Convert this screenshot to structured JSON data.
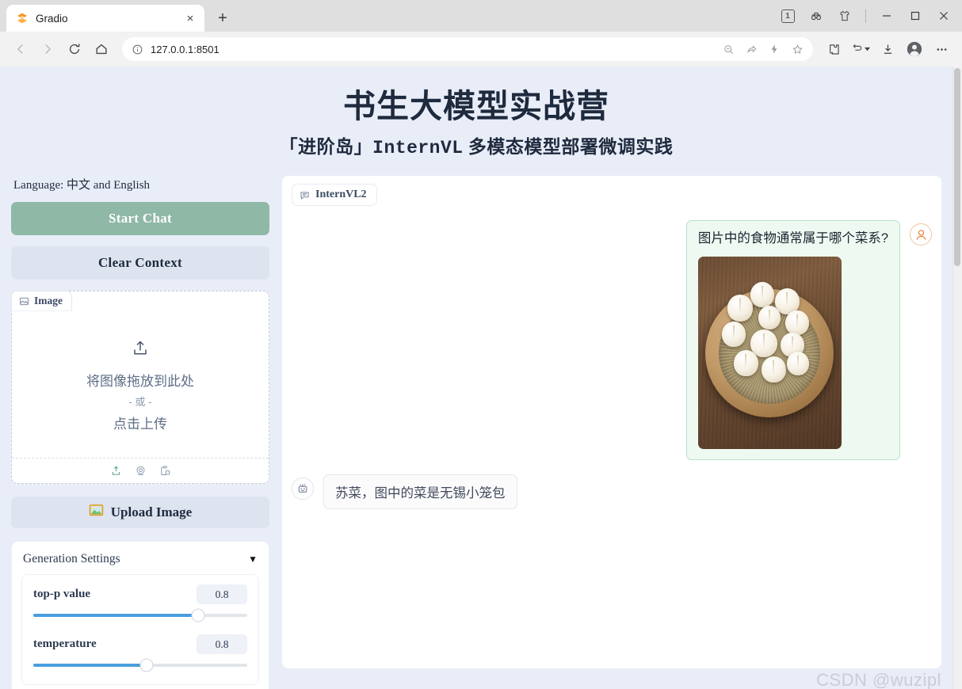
{
  "browser": {
    "tab": {
      "title": "Gradio",
      "favicon": "gradio-logo-icon",
      "close": "×"
    },
    "new_tab": "+",
    "nav": {
      "back": "back-icon",
      "forward": "forward-icon",
      "reload": "reload-icon",
      "home": "home-icon"
    },
    "omnibox": {
      "url": "127.0.0.1:8501",
      "info_icon": "site-info-icon"
    },
    "omni_actions": [
      "zoom-out-icon",
      "share-icon",
      "flash-icon",
      "bookmark-star-icon"
    ],
    "toolbar_actions": [
      "extensions-icon",
      "collections-icon",
      "downloads-icon",
      "profile-icon",
      "more-menu-icon"
    ],
    "window": {
      "tab_count": "1",
      "incognito": "incognito-icon",
      "theme": "theme-shirt-icon",
      "minimize": "—",
      "maximize": "▢",
      "close": "✕"
    }
  },
  "header": {
    "title": "书生大模型实战营",
    "subtitle_prefix": "「进阶岛」",
    "subtitle_mono": "InternVL",
    "subtitle_suffix": "多模态模型部署微调实践"
  },
  "sidebar": {
    "language_line": "Language: 中文 and English",
    "start_chat_label": "Start Chat",
    "clear_context_label": "Clear Context",
    "image_block": {
      "tag_label": "Image",
      "tag_icon": "image-icon",
      "upload_icon": "upload-arrow-icon",
      "drop_text": "将图像拖放到此处",
      "or_text": "- 或 -",
      "click_text": "点击上传",
      "actions": [
        "upload-icon",
        "webcam-icon",
        "paste-clipboard-icon"
      ]
    },
    "upload_button": {
      "label": "Upload Image",
      "icon": "picture-icon"
    },
    "settings": {
      "title": "Generation Settings",
      "caret": "▼",
      "sliders": [
        {
          "label": "top-p value",
          "value": "0.8",
          "fill_percent": 77
        },
        {
          "label": "temperature",
          "value": "0.8",
          "fill_percent": 53
        }
      ]
    }
  },
  "chat": {
    "tab_label": "InternVL2",
    "tab_icon": "chat-bubble-icon",
    "messages": [
      {
        "role": "user",
        "text": "图片中的食物通常属于哪个菜系?",
        "avatar": "user-avatar-icon",
        "has_image": true,
        "image_alt": "bamboo-steamer-with-soup-dumplings"
      },
      {
        "role": "assistant",
        "text": "苏菜，图中的菜是无锡小笼包",
        "avatar": "robot-avatar-icon"
      }
    ]
  },
  "watermark": "CSDN @wuzipl",
  "colors": {
    "page_bg": "#e9edf8",
    "primary_button": "#8fb8a7",
    "secondary_button": "#dde3ef",
    "slider_fill": "#4a9ede",
    "user_bubble_bg": "#eefaf1",
    "user_bubble_border": "#b7e2c9",
    "title_text": "#1e2a3d"
  }
}
